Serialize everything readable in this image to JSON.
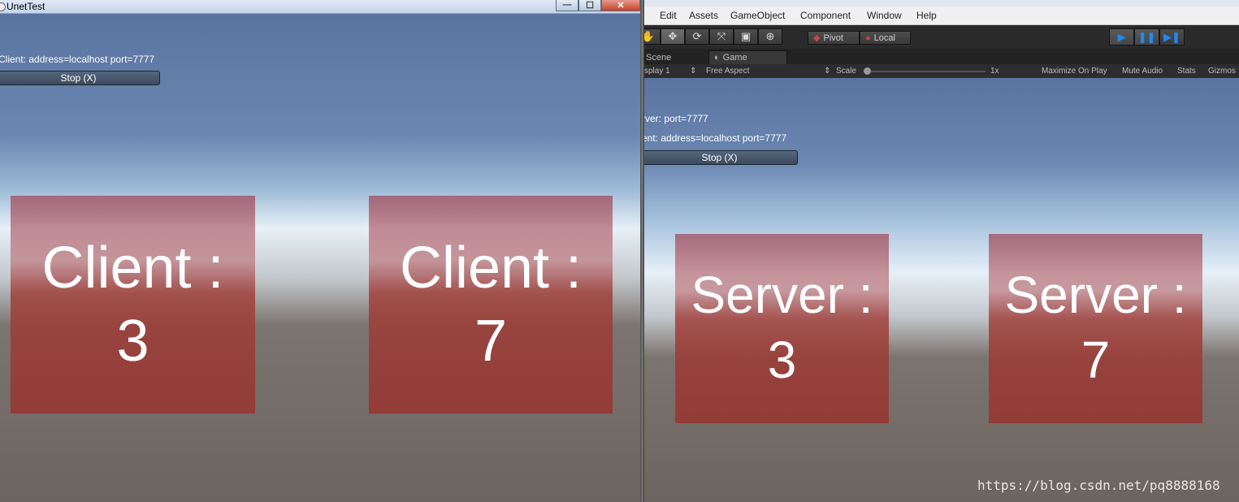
{
  "left_window": {
    "title": "UnetTest",
    "min_label": "—",
    "max_label": "☐",
    "close_label": "✕",
    "client_info": "Client: address=localhost port=7777",
    "stop_button": "Stop (X)",
    "quads": [
      {
        "title": "Client :",
        "value": "3"
      },
      {
        "title": "Client :",
        "value": "7"
      }
    ]
  },
  "editor": {
    "menu": [
      "Edit",
      "Assets",
      "GameObject",
      "Component",
      "Window",
      "Help"
    ],
    "tools": [
      "hand-icon",
      "move-icon",
      "rotate-icon",
      "scale-icon",
      "rect-icon",
      "transform-icon"
    ],
    "pivot_label": "Pivot",
    "local_label": "Local",
    "tabs": {
      "scene": "Scene",
      "game": "Game"
    },
    "game_toolbar": {
      "display": "splay 1",
      "aspect": "Free Aspect",
      "scale_label": "Scale",
      "scale_value": "1x",
      "maximize": "Maximize On Play",
      "mute": "Mute Audio",
      "stats": "Stats",
      "gizmos": "Gizmos"
    },
    "server_info": "rver: port=7777",
    "client_info": "ent: address=localhost port=7777",
    "stop_button": "Stop (X)",
    "quads": [
      {
        "title": "Server :",
        "value": "3"
      },
      {
        "title": "Server :",
        "value": "7"
      }
    ],
    "watermark": "https://blog.csdn.net/pq8888168"
  }
}
